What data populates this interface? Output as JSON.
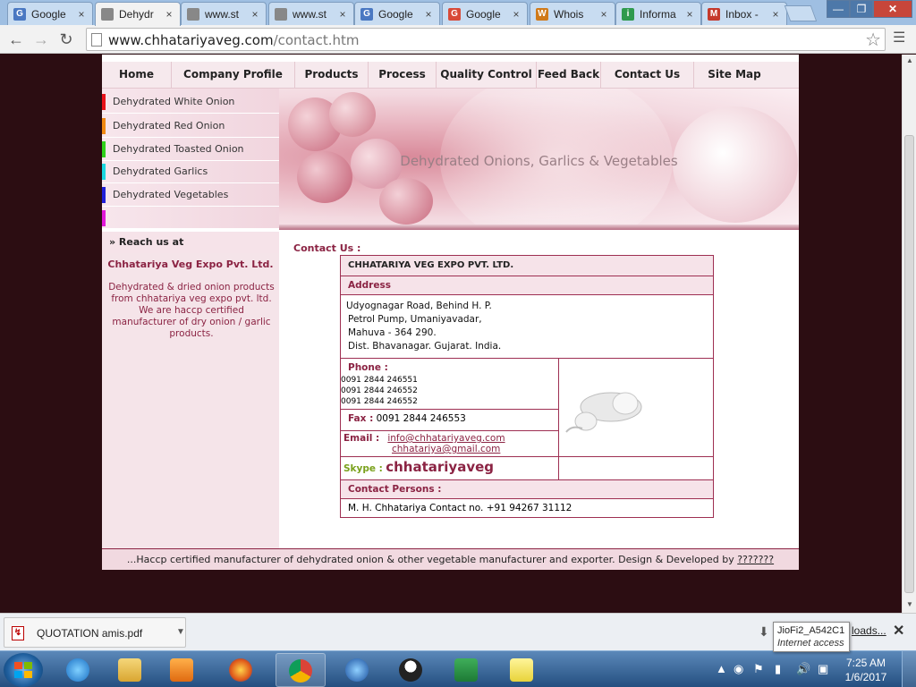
{
  "browser": {
    "tabs": [
      {
        "title": "Google",
        "icon": "google-g-icon",
        "color": "#4a78c2",
        "glyph": "G"
      },
      {
        "title": "Dehydr",
        "icon": "page-icon",
        "color": "#888888",
        "glyph": "",
        "active": true
      },
      {
        "title": "www.st",
        "icon": "page-icon",
        "color": "#888888",
        "glyph": ""
      },
      {
        "title": "www.st",
        "icon": "page-icon",
        "color": "#888888",
        "glyph": ""
      },
      {
        "title": "Google",
        "icon": "google-g-icon",
        "color": "#4a78c2",
        "glyph": "G"
      },
      {
        "title": "Google",
        "icon": "google-color-g-icon",
        "color": "#d84a38",
        "glyph": "G"
      },
      {
        "title": "Whois",
        "icon": "whois-icon",
        "color": "#d07a1a",
        "glyph": "W"
      },
      {
        "title": "Informa",
        "icon": "info-icon",
        "color": "#2f9a4e",
        "glyph": "i"
      },
      {
        "title": "Inbox -",
        "icon": "gmail-icon",
        "color": "#c5392b",
        "glyph": "M"
      }
    ],
    "url_host": "www.chhatariyaveg.com",
    "url_path": "/contact.htm"
  },
  "site": {
    "nav": [
      "Home",
      "Company Profile",
      "Products",
      "Process",
      "Quality Control",
      "Feed Back",
      "Contact Us",
      "Site Map"
    ],
    "left_menu": [
      {
        "label": "Dehydrated White Onion",
        "color": "#e8121a"
      },
      {
        "label": "Dehydrated Red Onion",
        "color": "#f08a14"
      },
      {
        "label": "Dehydrated Toasted Onion",
        "color": "#2fd11a"
      },
      {
        "label": "Dehydrated Garlics",
        "color": "#1ad8e0"
      },
      {
        "label": "Dehydrated Vegetables",
        "color": "#2020d8"
      },
      {
        "label": "",
        "color": "#e018d8"
      }
    ],
    "reach_heading": "»  Reach us at",
    "company_name": "Chhatariya Veg Expo Pvt. Ltd.",
    "company_desc": "Dehydrated & dried onion products from chhatariya veg expo pvt. ltd. We are haccp certified manufacturer of dry onion / garlic products.",
    "banner_tagline": "Dehydrated Onions, Garlics & Vegetables",
    "contact": {
      "title": "Contact Us :",
      "company_heading": "CHHATARIYA VEG EXPO PVT. LTD.",
      "address_label": "Address",
      "address_lines": [
        "Udyognagar Road, Behind H. P.",
        "Petrol Pump, Umaniyavadar,",
        "Mahuva - 364 290.",
        "Dist. Bhavanagar. Gujarat. India."
      ],
      "phone_label": "Phone :",
      "phones": [
        "0091 2844 246551",
        "0091 2844 246552",
        "0091 2844 246552"
      ],
      "fax_label": "Fax :",
      "fax": "0091 2844 246553",
      "email_label": "Email   :",
      "emails": [
        "info@chhatariyaveg.com",
        "chhatariya@gmail.com"
      ],
      "skype_label": "Skype :",
      "skype": "chhatariyaveg",
      "persons_label": "Contact Persons :",
      "person": "M. H. Chhatariya    Contact no.  +91 94267 31112"
    },
    "footer_text": "...Haccp certified manufacturer of dehydrated onion & other vegetable manufacturer and exporter.  Design & Developed by",
    "footer_link": "???????"
  },
  "downloads": {
    "file": "QUOTATION amis.pdf",
    "show_all": "loads..."
  },
  "tooltip": {
    "title": "JioFi2_A542C1",
    "sub": "Internet access"
  },
  "taskbar": {
    "time": "7:25 AM",
    "date": "1/6/2017"
  }
}
